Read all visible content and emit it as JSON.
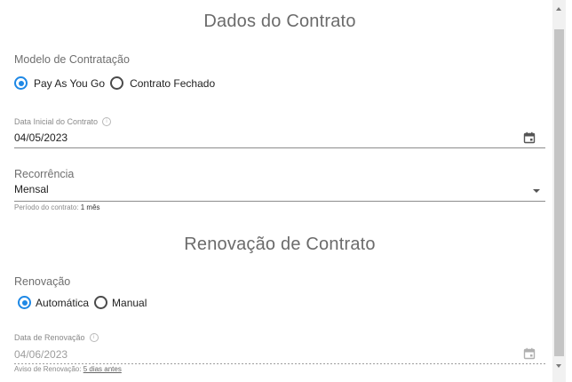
{
  "contract_section": {
    "title": "Dados do Contrato",
    "model_label": "Modelo de Contratação",
    "model_options": [
      "Pay As You Go",
      "Contrato Fechado"
    ],
    "selected_model": "Pay As You Go",
    "start_date_label": "Data Inicial do Contrato",
    "start_date_value": "04/05/2023",
    "recurrence_label": "Recorrência",
    "recurrence_value": "Mensal",
    "period_prefix": "Período do contrato:",
    "period_value": "1 mês"
  },
  "renewal_section": {
    "title": "Renovação de Contrato",
    "renewal_label": "Renovação",
    "renewal_options": [
      "Automática",
      "Manual"
    ],
    "selected_renewal": "Automática",
    "renewal_date_label": "Data de Renovação",
    "renewal_date_value": "04/06/2023",
    "notice_prefix": "Aviso de Renovação:",
    "notice_value": "5 dias antes"
  },
  "icons": {
    "info": "info-icon",
    "calendar": "calendar-icon",
    "dropdown": "chevron-down-icon"
  },
  "colors": {
    "accent": "#1e88e5"
  }
}
